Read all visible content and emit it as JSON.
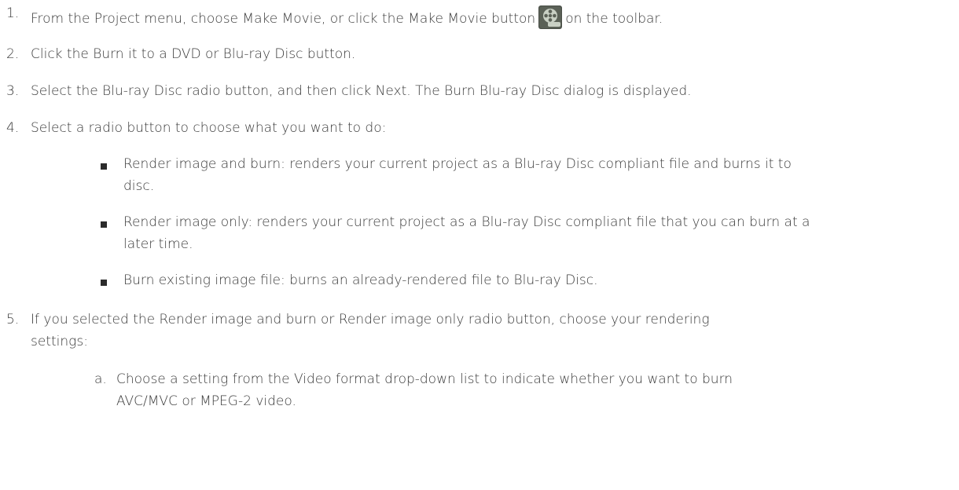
{
  "steps": [
    {
      "number": "1.",
      "text_before_icon": "From the Project menu, choose Make Movie, or click the Make Movie button",
      "icon": "make-movie-icon",
      "text_after_icon": "on the toolbar."
    },
    {
      "number": "2.",
      "text": "Click the Burn it to a DVD or Blu-ray Disc button."
    },
    {
      "number": "3.",
      "text": "Select the Blu-ray Disc radio button, and then click Next. The Burn Blu-ray Disc dialog is displayed."
    },
    {
      "number": "4.",
      "text": "Select a radio button to choose what you want to do:",
      "bullets": [
        {
          "line1": "Render image and burn: renders your current project as a Blu-ray Disc compliant file and burns it to",
          "line2": "disc."
        },
        {
          "line1": "Render image only: renders your current project as a Blu-ray Disc compliant file that you can burn at a",
          "line2": "later time."
        },
        {
          "line1": "Burn existing image file: burns an already-rendered file to Blu-ray Disc."
        }
      ]
    },
    {
      "number": "5.",
      "line1": "If you selected the Render image and burn or Render image only radio button, choose your rendering",
      "line2": "settings:",
      "substeps": [
        {
          "letter": "a.",
          "line1": "Choose a setting from the Video format drop-down list to indicate whether you want to burn",
          "line2": "AVC/MVC or MPEG-2 video."
        }
      ]
    }
  ],
  "colors": {
    "text": "#3a3a3a",
    "bullet": "#2b2b2b",
    "icon_bg": "#4a4f47",
    "icon_reel": "#c9d0c4"
  }
}
